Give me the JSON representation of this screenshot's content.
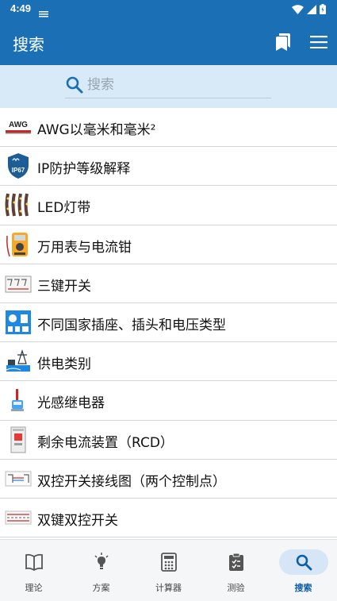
{
  "status_bar": {
    "time": "4:49"
  },
  "app_bar": {
    "title": "搜索"
  },
  "search": {
    "placeholder": "搜索",
    "value": ""
  },
  "list_items": [
    {
      "label": "AWG以毫米和毫米²",
      "icon": "awg-icon"
    },
    {
      "label": "IP防护等级解释",
      "icon": "ip67-shield-icon"
    },
    {
      "label": "LED灯带",
      "icon": "led-strip-icon"
    },
    {
      "label": "万用表与电流钳",
      "icon": "multimeter-icon"
    },
    {
      "label": "三键开关",
      "icon": "three-key-switch-icon"
    },
    {
      "label": "不同国家插座、插头和电压类型",
      "icon": "socket-plug-icon"
    },
    {
      "label": "供电类别",
      "icon": "power-supply-icon"
    },
    {
      "label": "光感继电器",
      "icon": "light-relay-icon"
    },
    {
      "label": "剩余电流装置（RCD）",
      "icon": "rcd-icon"
    },
    {
      "label": "双控开关接线图（两个控制点）",
      "icon": "two-way-switch-wiring-icon"
    },
    {
      "label": "双键双控开关",
      "icon": "double-key-two-way-switch-icon"
    }
  ],
  "awg_badge": "AWG",
  "ip_badge": "IP67",
  "bottom_nav": [
    {
      "label": "理论",
      "icon": "book-icon",
      "active": false
    },
    {
      "label": "方案",
      "icon": "lightbulb-icon",
      "active": false
    },
    {
      "label": "计算器",
      "icon": "calculator-icon",
      "active": false
    },
    {
      "label": "测验",
      "icon": "clipboard-check-icon",
      "active": false
    },
    {
      "label": "搜索",
      "icon": "search-icon",
      "active": true
    }
  ],
  "colors": {
    "primary": "#1a6fb5",
    "search_bg": "#d8eaf8",
    "active_pill": "#d6e6f7"
  }
}
